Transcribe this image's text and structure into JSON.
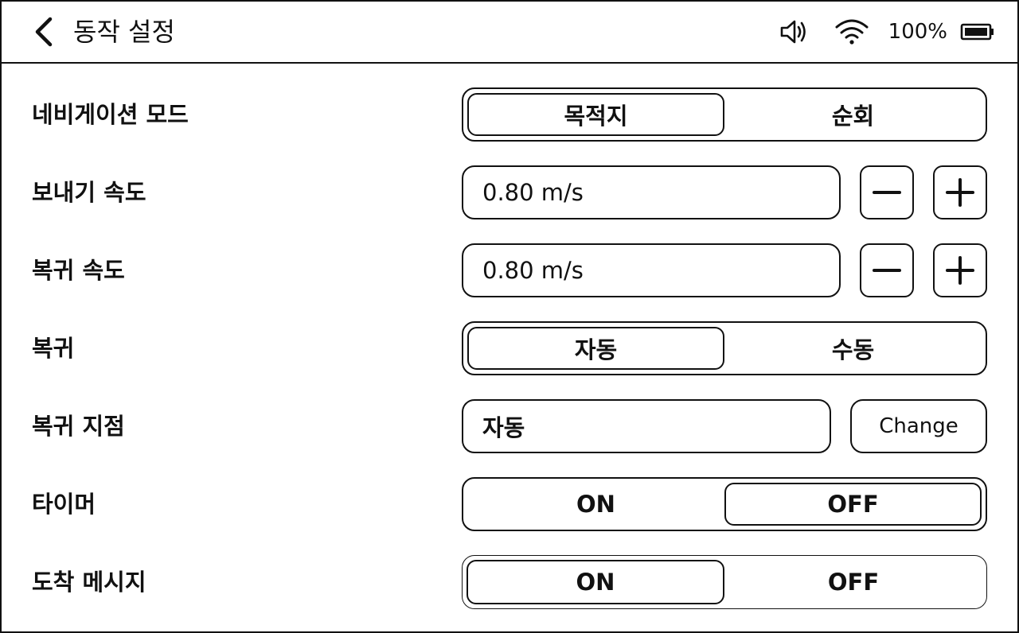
{
  "header": {
    "title": "동작 설정",
    "battery_percent": "100%",
    "icons": [
      "back-arrow-icon",
      "speaker-icon",
      "wifi-icon",
      "battery-icon"
    ]
  },
  "settings": {
    "navigation_mode": {
      "label": "네비게이션 모드",
      "options": [
        "목적지",
        "순회"
      ],
      "selected": "목적지"
    },
    "send_speed": {
      "label": "보내기 속도",
      "value": "0.80 m/s",
      "decrement": "−",
      "increment": "+"
    },
    "return_speed": {
      "label": "복귀 속도",
      "value": "0.80 m/s",
      "decrement": "−",
      "increment": "+"
    },
    "return_mode": {
      "label": "복귀",
      "options": [
        "자동",
        "수동"
      ],
      "selected": "자동"
    },
    "return_point": {
      "label": "복귀 지점",
      "value": "자동",
      "button": "Change"
    },
    "timer": {
      "label": "타이머",
      "options": [
        "ON",
        "OFF"
      ],
      "selected": "OFF"
    },
    "arrival_message": {
      "label": "도착 메시지",
      "options": [
        "ON",
        "OFF"
      ],
      "selected": "ON"
    }
  },
  "colors": {
    "foreground": "#111111",
    "background": "#ffffff"
  }
}
